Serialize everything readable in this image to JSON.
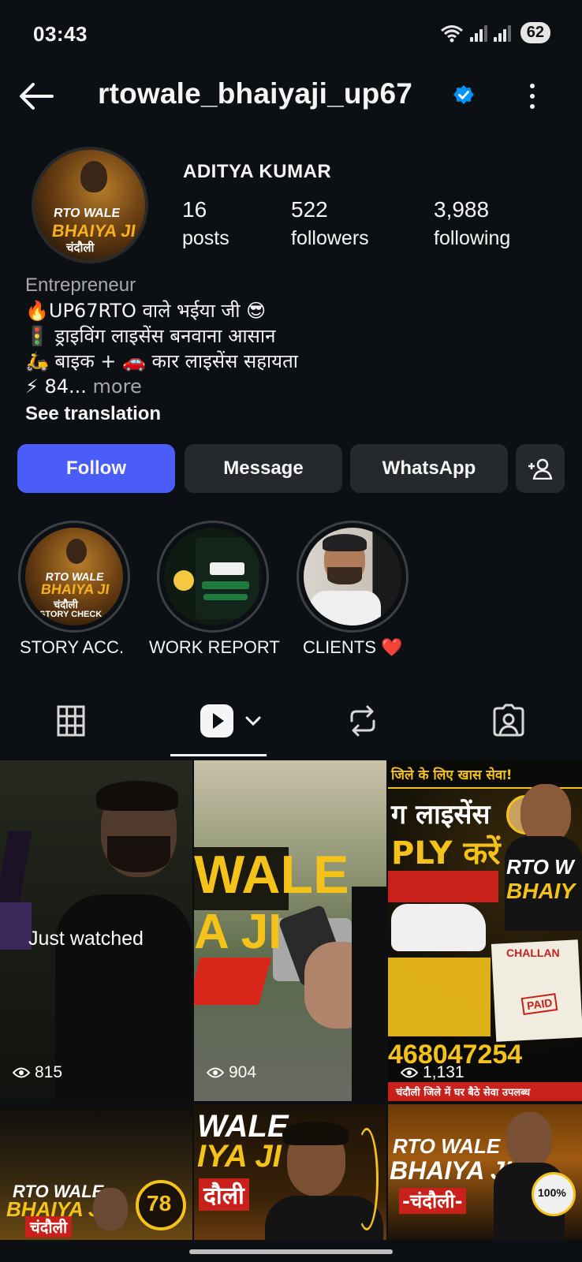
{
  "status_bar": {
    "time": "03:43",
    "battery": "62"
  },
  "header": {
    "username": "rtowale_bhaiyaji_up67"
  },
  "profile": {
    "display_name": "ADITYA KUMAR",
    "avatar_text": [
      "RTO WALE",
      "BHAIYA JI",
      "चंदौली"
    ],
    "stats": [
      {
        "value": "16",
        "label": "posts"
      },
      {
        "value": "522",
        "label": "followers"
      },
      {
        "value": "3,988",
        "label": "following"
      }
    ]
  },
  "bio": {
    "category": "Entrepreneur",
    "lines": [
      "🔥UP67RTO वाले भईया जी 😎",
      "🚦 ड्राइविंग लाइसेंस बनवाना आसान",
      "🛵 बाइक + 🚗 कार लाइसेंस सहायता"
    ],
    "truncated": "⚡ 84...",
    "more": "more",
    "see_translation": "See translation"
  },
  "actions": {
    "follow": "Follow",
    "message": "Message",
    "whatsapp": "WhatsApp"
  },
  "highlights": [
    {
      "label": "STORY ACC."
    },
    {
      "label": "WORK REPORT"
    },
    {
      "label": "CLIENTS ❤️"
    }
  ],
  "grid": {
    "just_watched": "Just watched",
    "views": [
      "815",
      "904",
      "1,131"
    ],
    "poster_texts": {
      "p2_big": "WALE",
      "p2_big2": "A JI",
      "p3_top": "जिले के लिए खास सेवा!",
      "p3_license": "ग लाइसेंस",
      "p3_ply": "PLY करें",
      "p3_phone": "468047254",
      "p3_challan": "CHALLAN",
      "p3_paid": "PAID",
      "p3_bottom": "चंदौली जिले में घर बैठे सेवा उपलब्ध",
      "p3_rto": "RTO W",
      "p3_bhai": "BHAIY",
      "p4_a": "RTO WALE",
      "p4_b": "BHAIYA JI",
      "p4_c": "चंदौली",
      "p4_n": "78",
      "p5_a": "WALE",
      "p5_b": "IYA JI",
      "p5_c": "दौली",
      "p6_a": "RTO WALE",
      "p6_b": "BHAIYA JI",
      "p6_c": "-चंदौली-",
      "p6_badge": "100%"
    }
  }
}
